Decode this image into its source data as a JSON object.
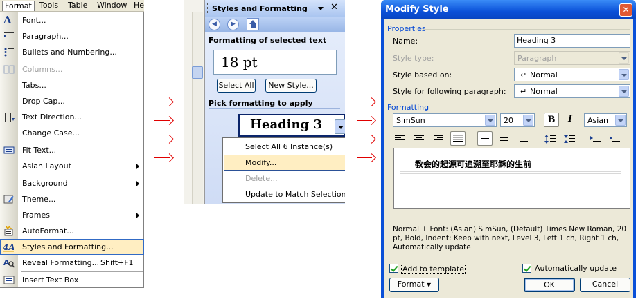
{
  "menubar": {
    "items": [
      "Format",
      "Tools",
      "Table",
      "Window",
      "He"
    ]
  },
  "format_menu": {
    "items": [
      {
        "label": "Font...",
        "icon": "font-a-icon"
      },
      {
        "label": "Paragraph...",
        "icon": "paragraph-icon"
      },
      {
        "label": "Bullets and Numbering...",
        "icon": "bullets-icon"
      },
      {
        "label": "Columns...",
        "icon": "columns-icon",
        "disabled": true
      },
      {
        "label": "Tabs..."
      },
      {
        "label": "Drop Cap..."
      },
      {
        "label": "Text Direction...",
        "icon": "text-direction-icon"
      },
      {
        "label": "Change Case..."
      },
      {
        "label": "Fit Text...",
        "icon": "fit-text-icon"
      },
      {
        "label": "Asian Layout",
        "submenu": true
      },
      {
        "label": "Background",
        "submenu": true
      },
      {
        "label": "Theme...",
        "icon": "theme-icon"
      },
      {
        "label": "Frames",
        "submenu": true
      },
      {
        "label": "AutoFormat...",
        "icon": "autoformat-icon"
      },
      {
        "label": "Styles and Formatting...",
        "icon": "styles-formatting-icon",
        "highlighted": true
      },
      {
        "label": "Reveal Formatting...",
        "icon": "reveal-formatting-icon",
        "shortcut": "Shift+F1"
      },
      {
        "label": "Insert Text Box",
        "icon": "text-box-icon"
      }
    ]
  },
  "task_pane": {
    "title": "Styles and Formatting",
    "formatting_label": "Formatting of selected text",
    "current_format": "18 pt",
    "select_all_button": "Select All",
    "new_style_button": "New Style...",
    "pick_label": "Pick formatting to apply",
    "selected_style": "Heading 3",
    "context_menu": [
      {
        "label": "Select All 6 Instance(s)"
      },
      {
        "label": "Modify...",
        "highlighted": true
      },
      {
        "label": "Delete...",
        "disabled": true
      },
      {
        "label": "Update to Match Selection"
      }
    ]
  },
  "dialog": {
    "title": "Modify Style",
    "properties_label": "Properties",
    "name_label": "Name:",
    "name_value": "Heading 3",
    "style_type_label": "Style type:",
    "style_type_value": "Paragraph",
    "based_on_label": "Style based on:",
    "based_on_value": "Normal",
    "following_label": "Style for following paragraph:",
    "following_value": "Normal",
    "formatting_label": "Formatting",
    "font_value": "SimSun",
    "size_value": "20",
    "bold_label": "B",
    "italic_label": "I",
    "script_value": "Asian",
    "preview_text": "教会的起源可追溯至耶稣的生前",
    "description": "Normal + Font: (Asian) SimSun, (Default) Times New Roman, 20 pt, Bold, Indent: Keep with next, Level 3, Left  1 ch, Right  1 ch, Automatically update",
    "add_to_template_label": "Add to template",
    "auto_update_label": "Automatically update",
    "format_button": "Format",
    "ok_button": "OK",
    "cancel_button": "Cancel",
    "close_glyph": "✕"
  },
  "colors": {
    "arrow": "#e00000",
    "highlight": "#ffeec2",
    "xp_blue": "#0a50d8",
    "group_label": "#0046d5"
  }
}
